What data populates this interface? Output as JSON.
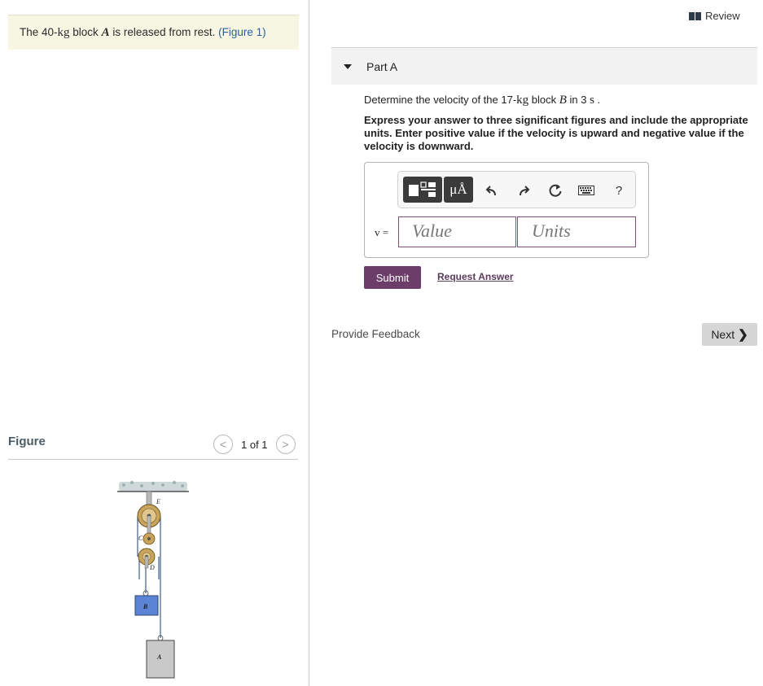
{
  "problem": {
    "prefix": "The 40-",
    "unit_kg": "kg",
    "middle": " block ",
    "var_A": "A",
    "suffix": " is released from rest. ",
    "figure_link": "(Figure 1)"
  },
  "figure": {
    "header": "Figure",
    "pager_count": "1 of 1",
    "prev_glyph": "<",
    "next_glyph": ">",
    "labels": {
      "E": "E",
      "C": "C",
      "D": "D",
      "B": "B",
      "A": "A"
    }
  },
  "review": {
    "label": "Review"
  },
  "part": {
    "title": "Part A"
  },
  "question": {
    "prefix": "Determine the velocity of the 17-",
    "unit_kg": "kg",
    "middle": " block ",
    "var_B": "B",
    "in": " in 3 ",
    "unit_s": "s",
    "period": " ."
  },
  "instructions": "Express your answer to three significant figures and include the appropriate units. Enter positive value if the velocity is upward and negative value if the velocity is downward.",
  "toolbar": {
    "mu_label": "μÅ",
    "help_label": "?"
  },
  "answer": {
    "variable_label": "v =",
    "value_placeholder": "Value",
    "units_placeholder": "Units"
  },
  "buttons": {
    "submit": "Submit",
    "request_answer": "Request Answer",
    "provide_feedback": "Provide Feedback",
    "next": "Next"
  },
  "colors": {
    "submit_bg": "#6b3d68",
    "problem_bg": "#f7f6e2",
    "input_border": "#7f4f7a",
    "block_B": "#5b84d6",
    "block_A": "#c9c9c9",
    "pulley": "#c9a55c"
  }
}
